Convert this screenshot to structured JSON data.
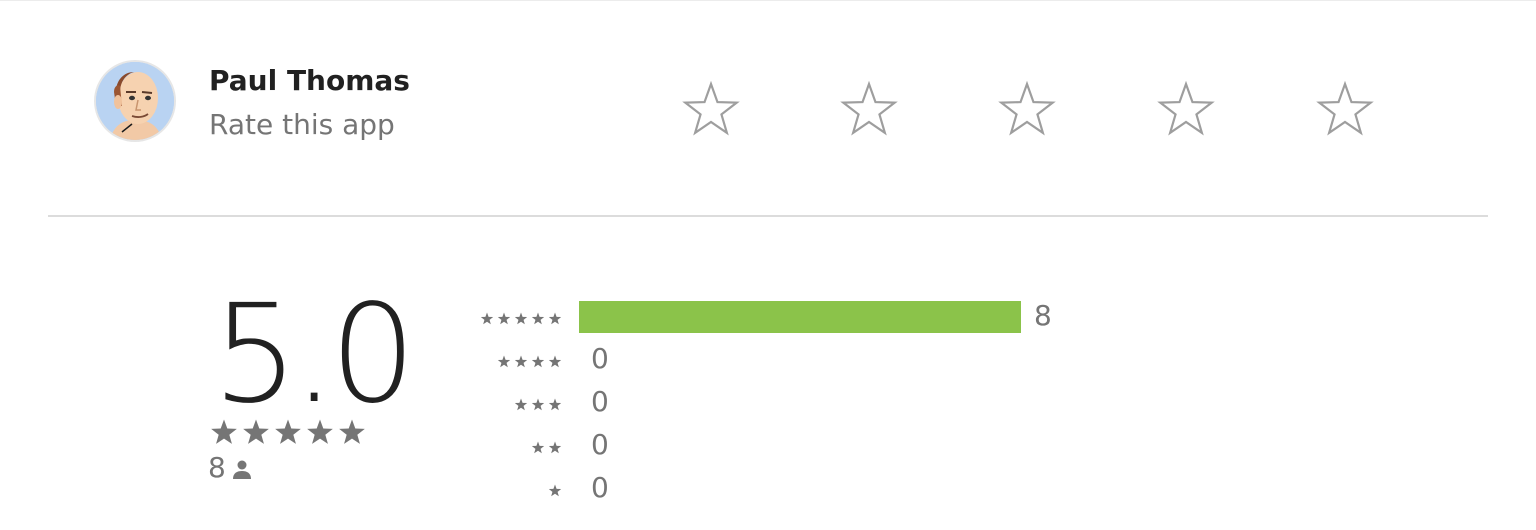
{
  "user": {
    "name": "Paul Thomas",
    "prompt": "Rate this app",
    "avatar_icon": "bitmoji-avatar"
  },
  "rate_stars": {
    "count": 5,
    "icon": "outline-star-icon",
    "color": "#9e9e9e"
  },
  "summary": {
    "average": "5.0",
    "stars_filled": 5,
    "total_ratings": "8",
    "ratings_icon": "person-icon",
    "star_color": "#757575"
  },
  "histogram": {
    "bar_color": "#8bc34a",
    "max_count": 8,
    "rows": [
      {
        "stars": 5,
        "count": "8",
        "value": 8
      },
      {
        "stars": 4,
        "count": "0",
        "value": 0
      },
      {
        "stars": 3,
        "count": "0",
        "value": 0
      },
      {
        "stars": 2,
        "count": "0",
        "value": 0
      },
      {
        "stars": 1,
        "count": "0",
        "value": 0
      }
    ]
  }
}
